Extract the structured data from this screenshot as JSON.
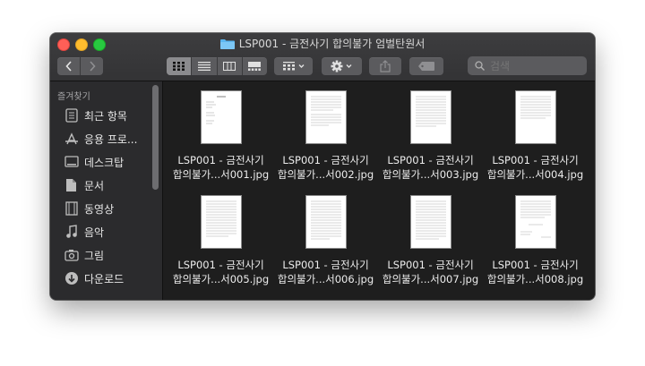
{
  "window": {
    "title": "LSP001 - 금전사기 합의불가 엄벌탄원서",
    "search_placeholder": "검색"
  },
  "sidebar": {
    "heading": "즐겨찾기",
    "items": [
      {
        "label": "최근 항목",
        "icon": "recent-icon"
      },
      {
        "label": "응용 프로...",
        "icon": "applications-icon"
      },
      {
        "label": "데스크탑",
        "icon": "desktop-icon"
      },
      {
        "label": "문서",
        "icon": "documents-icon"
      },
      {
        "label": "동영상",
        "icon": "movies-icon"
      },
      {
        "label": "음악",
        "icon": "music-icon"
      },
      {
        "label": "그림",
        "icon": "pictures-icon"
      },
      {
        "label": "다운로드",
        "icon": "downloads-icon"
      }
    ]
  },
  "files": [
    {
      "line1": "LSP001 - 금전사기",
      "line2": "합의불가...서001.jpg"
    },
    {
      "line1": "LSP001 - 금전사기",
      "line2": "합의불가...서002.jpg"
    },
    {
      "line1": "LSP001 - 금전사기",
      "line2": "합의불가...서003.jpg"
    },
    {
      "line1": "LSP001 - 금전사기",
      "line2": "합의불가...서004.jpg"
    },
    {
      "line1": "LSP001 - 금전사기",
      "line2": "합의불가...서005.jpg"
    },
    {
      "line1": "LSP001 - 금전사기",
      "line2": "합의불가...서006.jpg"
    },
    {
      "line1": "LSP001 - 금전사기",
      "line2": "합의불가...서007.jpg"
    },
    {
      "line1": "LSP001 - 금전사기",
      "line2": "합의불가...서008.jpg"
    }
  ],
  "colors": {
    "window_bg": "#1e1e1e",
    "sidebar_bg": "#2b2b2d",
    "titlebar_bg": "#363638",
    "close": "#fe5f57",
    "minimize": "#febc2e",
    "maximize": "#28c840",
    "folder": "#5bb6f0"
  }
}
